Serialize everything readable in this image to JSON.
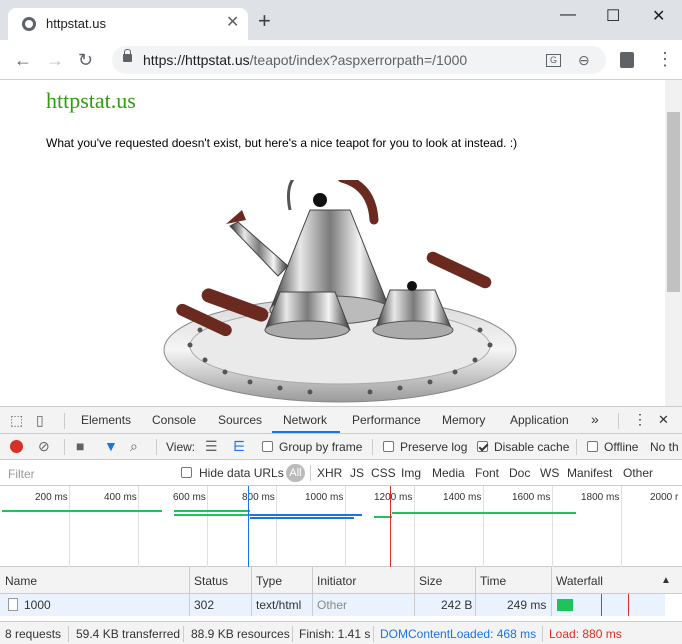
{
  "browser": {
    "tab_title": "httpstat.us",
    "tab_close": "✕",
    "new_tab": "+",
    "window_controls": {
      "minimize": "—",
      "maximize": "☐",
      "close": "✕"
    },
    "nav": {
      "back": "←",
      "forward": "→",
      "reload": "↻"
    },
    "url_host": "https://httpstat.us",
    "url_path": "/teapot/index?aspxerrorpath=/1000",
    "menu": "⋮"
  },
  "page": {
    "title": "httpstat.us",
    "message": "What you've requested doesn't exist, but here's a nice teapot for you to look at instead. :)"
  },
  "devtools": {
    "tabs": [
      "Elements",
      "Console",
      "Sources",
      "Network",
      "Performance",
      "Memory",
      "Application"
    ],
    "more": "»",
    "menu": "⋮",
    "close": "✕",
    "toolbar": {
      "view_label": "View:",
      "group_by_frame": "Group by frame",
      "preserve_log": "Preserve log",
      "disable_cache": "Disable cache",
      "offline": "Offline",
      "throttle": "No th"
    },
    "filter": {
      "placeholder": "Filter",
      "hide_data_urls": "Hide data URLs",
      "types": [
        "All",
        "XHR",
        "JS",
        "CSS",
        "Img",
        "Media",
        "Font",
        "Doc",
        "WS",
        "Manifest",
        "Other"
      ]
    },
    "overview_ticks": [
      "200 ms",
      "400 ms",
      "600 ms",
      "800 ms",
      "1000 ms",
      "1200 ms",
      "1400 ms",
      "1600 ms",
      "1800 ms",
      "2000 r"
    ],
    "columns": [
      "Name",
      "Status",
      "Type",
      "Initiator",
      "Size",
      "Time",
      "Waterfall"
    ],
    "rows": [
      {
        "name": "1000",
        "status": "302",
        "type": "text/html",
        "initiator": "Other",
        "size": "242 B",
        "time": "249 ms"
      }
    ],
    "summary": {
      "requests": "8 requests",
      "transferred": "59.4 KB transferred",
      "resources": "88.9 KB resources",
      "finish": "Finish: 1.41 s",
      "dom": "DOMContentLoaded: 468 ms",
      "load": "Load: 880 ms"
    }
  },
  "colors": {
    "site_title": "#2e9d0f",
    "dom_content_loaded": "#1a73e8",
    "load": "#d93025",
    "waterfall_bar": "#1fc35c"
  }
}
